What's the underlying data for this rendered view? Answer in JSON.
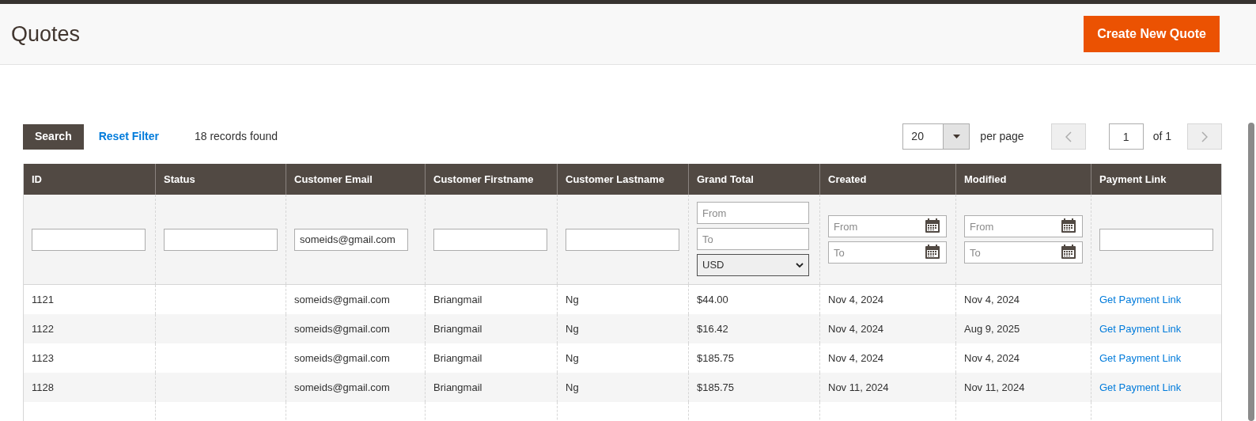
{
  "page": {
    "title": "Quotes",
    "create_button": "Create New Quote"
  },
  "toolbar": {
    "search_button": "Search",
    "reset_link": "Reset Filter",
    "records": "18 records found",
    "per_page": {
      "value": "20",
      "label": "per page"
    },
    "pager": {
      "value": "1",
      "total": "of 1"
    }
  },
  "table": {
    "columns": [
      "ID",
      "Status",
      "Customer Email",
      "Customer Firstname",
      "Customer Lastname",
      "Grand Total",
      "Created",
      "Modified",
      "Payment Link"
    ],
    "filters": [
      {
        "kind": "text"
      },
      {
        "kind": "text"
      },
      {
        "kind": "text",
        "value": "someids@gmail.com"
      },
      {
        "kind": "text"
      },
      {
        "kind": "text"
      },
      {
        "kind": "range",
        "from_placeholder": "From",
        "to_placeholder": "To",
        "currency": "USD"
      },
      {
        "kind": "date_range",
        "from_placeholder": "From",
        "to_placeholder": "To"
      },
      {
        "kind": "date_range",
        "from_placeholder": "From",
        "to_placeholder": "To"
      },
      {
        "kind": "text"
      }
    ],
    "rows": [
      [
        "1121",
        "",
        "someids@gmail.com",
        "Briangmail",
        "Ng",
        "$44.00",
        "Nov 4, 2024",
        "Nov 4, 2024",
        "Get Payment Link"
      ],
      [
        "1122",
        "",
        "someids@gmail.com",
        "Briangmail",
        "Ng",
        "$16.42",
        "Nov 4, 2024",
        "Aug 9, 2025",
        "Get Payment Link"
      ],
      [
        "1123",
        "",
        "someids@gmail.com",
        "Briangmail",
        "Ng",
        "$185.75",
        "Nov 4, 2024",
        "Nov 4, 2024",
        "Get Payment Link"
      ],
      [
        "1128",
        "",
        "someids@gmail.com",
        "Briangmail",
        "Ng",
        "$185.75",
        "Nov 11, 2024",
        "Nov 11, 2024",
        "Get Payment Link"
      ]
    ]
  }
}
